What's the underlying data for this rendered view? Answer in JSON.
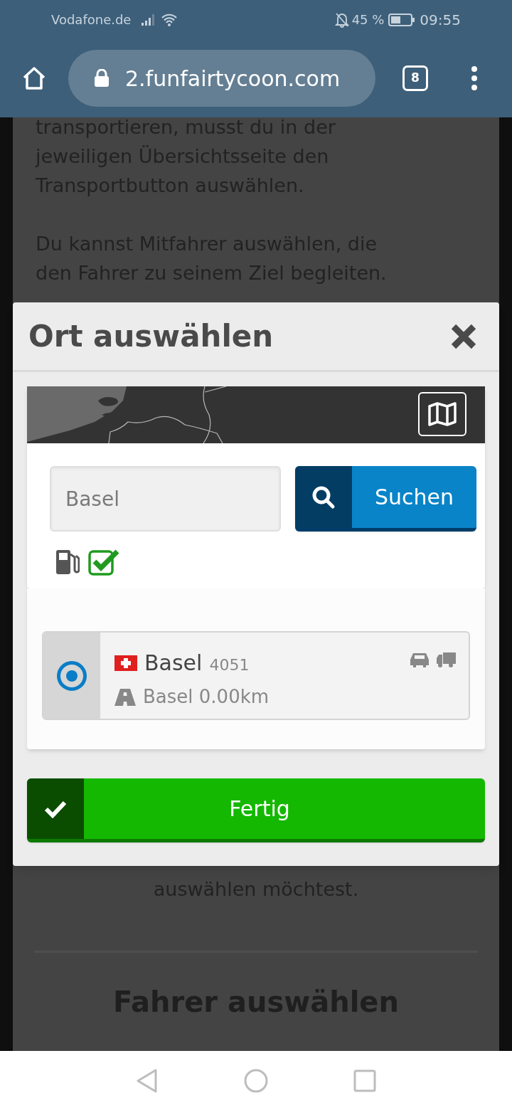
{
  "status_bar": {
    "carrier": "Vodafone.de",
    "battery": "45 %",
    "time": "09:55"
  },
  "browser": {
    "url": "2.funfairtycoon.com",
    "tab_count": "8"
  },
  "background_page": {
    "paragraphs": [
      [
        "transportieren, musst du in der",
        "jeweiligen Übersichtsseite den",
        "Transportbutton auswählen."
      ],
      [
        "Du kannst Mitfahrer auswählen, die",
        "den Fahrer zu seinem Ziel begleiten."
      ]
    ],
    "lower_text": "auswählen möchtest.",
    "heading": "Fahrer auswählen"
  },
  "dialog": {
    "title": "Ort auswählen",
    "search": {
      "placeholder": "Basel",
      "button": "Suchen"
    },
    "fuel_filter": {
      "checked": true
    },
    "results": [
      {
        "name": "Basel",
        "postcode": "4051",
        "route": "Basel 0.00km",
        "selected": true
      }
    ],
    "done_button": "Fertig"
  }
}
